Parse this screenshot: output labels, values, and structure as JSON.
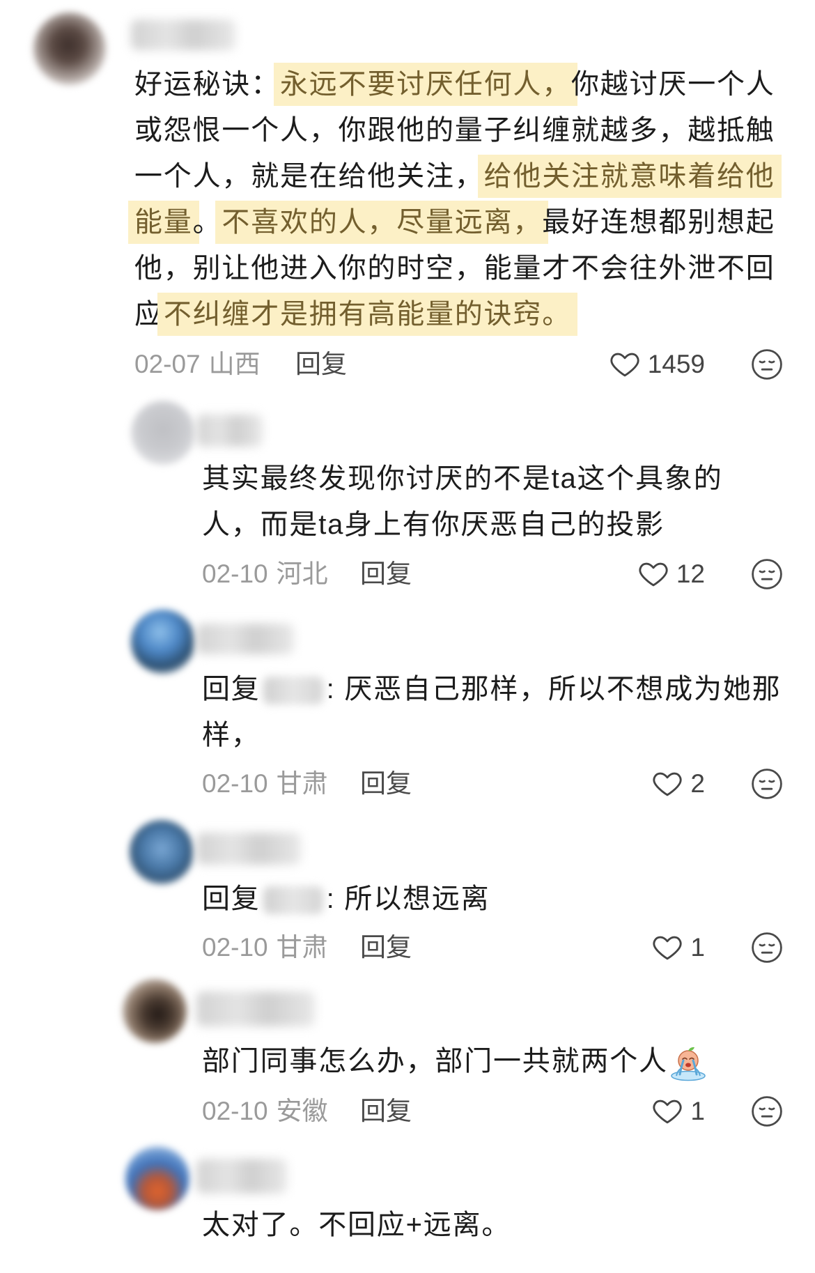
{
  "comments": [
    {
      "lines": [
        [
          {
            "t": "好运秘诀："
          },
          {
            "t": "永远不要讨厌任何人，",
            "hl": true
          },
          {
            "t": "你越讨厌一个人"
          }
        ],
        [
          {
            "t": "或怨恨一个人，你跟他的量子纠缠就越多，越抵触"
          }
        ],
        [
          {
            "t": "一个人，就是在给他关注，"
          },
          {
            "t": "给他关注就意味着给他",
            "hl": true
          }
        ],
        [
          {
            "t": "能量",
            "hl": true
          },
          {
            "t": "。"
          },
          {
            "t": "不喜欢的人，尽量远离，",
            "hl": true
          },
          {
            "t": "最好连想都别想起"
          }
        ],
        [
          {
            "t": "他，别让他进入你的时空，能量才不会往外泄不回"
          }
        ],
        [
          {
            "t": "应"
          },
          {
            "t": "不纠缠才是拥有高能量的诀窍。",
            "hl": true
          }
        ]
      ],
      "date": "02-07",
      "region": "山西",
      "reply_label": "回复",
      "likes": "1459"
    },
    {
      "lines": [
        [
          {
            "t": "其实最终发现你讨厌的不是ta这个具象的"
          }
        ],
        [
          {
            "t": "人，而是ta身上有你厌恶自己的投影"
          }
        ]
      ],
      "date": "02-10",
      "region": "河北",
      "reply_label": "回复",
      "likes": "12"
    },
    {
      "lines": [
        [
          {
            "t": "回复"
          },
          {
            "t": ": 厌恶自己那样，所以不想成为她那"
          }
        ],
        [
          {
            "t": "样，"
          }
        ]
      ],
      "date": "02-10",
      "region": "甘肃",
      "reply_label": "回复",
      "likes": "2"
    },
    {
      "lines": [
        [
          {
            "t": "回复"
          },
          {
            "t": ": 所以想远离"
          }
        ]
      ],
      "date": "02-10",
      "region": "甘肃",
      "reply_label": "回复",
      "likes": "1"
    },
    {
      "lines": [
        [
          {
            "t": "部门同事怎么办，部门一共就两个人"
          }
        ]
      ],
      "emoji_icon": "crying-emoji-icon",
      "date": "02-10",
      "region": "安徽",
      "reply_label": "回复",
      "likes": "1"
    },
    {
      "lines": [
        [
          {
            "t": "太对了。不回应+远离。"
          }
        ]
      ]
    }
  ],
  "icons": {
    "like": "heart-outline-icon",
    "dislike": "dislike-face-icon"
  },
  "colors": {
    "background": "#ffffff",
    "text": "#1c1c1c",
    "highlight_bg": "#fcf0c6",
    "highlight_text": "#735f2e",
    "meta": "#9a9a9a",
    "reply_label": "#4a4a4a",
    "like_count": "#444444"
  }
}
